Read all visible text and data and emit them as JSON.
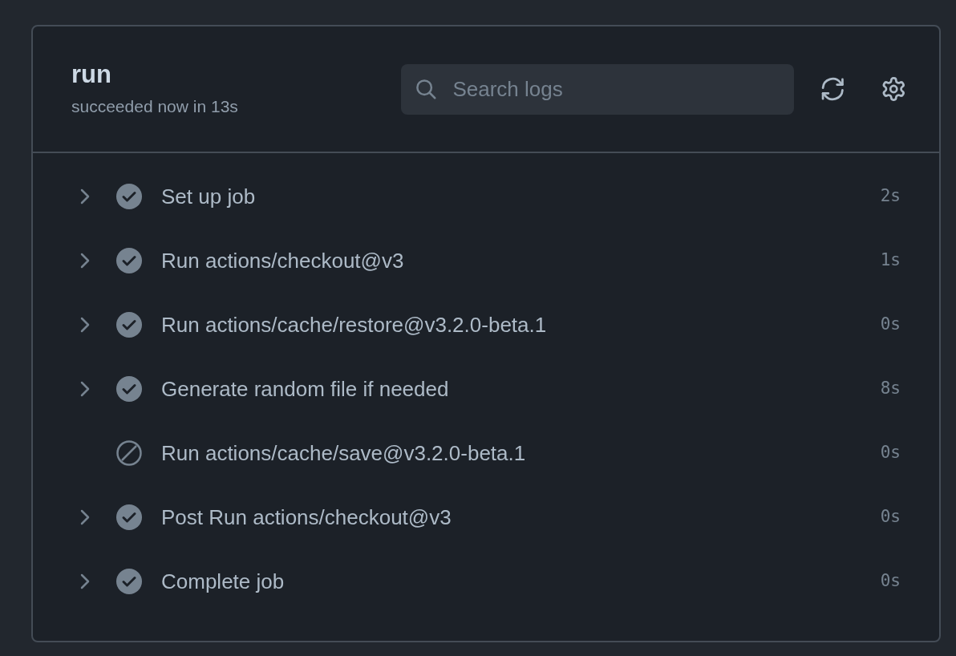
{
  "job": {
    "title": "run",
    "subtitle": "succeeded now in 13s"
  },
  "search": {
    "placeholder": "Search logs"
  },
  "steps": [
    {
      "name": "Set up job",
      "duration": "2s",
      "kind": "success",
      "expandable": true
    },
    {
      "name": "Run actions/checkout@v3",
      "duration": "1s",
      "kind": "success",
      "expandable": true
    },
    {
      "name": "Run actions/cache/restore@v3.2.0-beta.1",
      "duration": "0s",
      "kind": "success",
      "expandable": true
    },
    {
      "name": "Generate random file if needed",
      "duration": "8s",
      "kind": "success",
      "expandable": true
    },
    {
      "name": "Run actions/cache/save@v3.2.0-beta.1",
      "duration": "0s",
      "kind": "skipped",
      "expandable": false
    },
    {
      "name": "Post Run actions/checkout@v3",
      "duration": "0s",
      "kind": "success",
      "expandable": true
    },
    {
      "name": "Complete job",
      "duration": "0s",
      "kind": "success",
      "expandable": true
    }
  ]
}
